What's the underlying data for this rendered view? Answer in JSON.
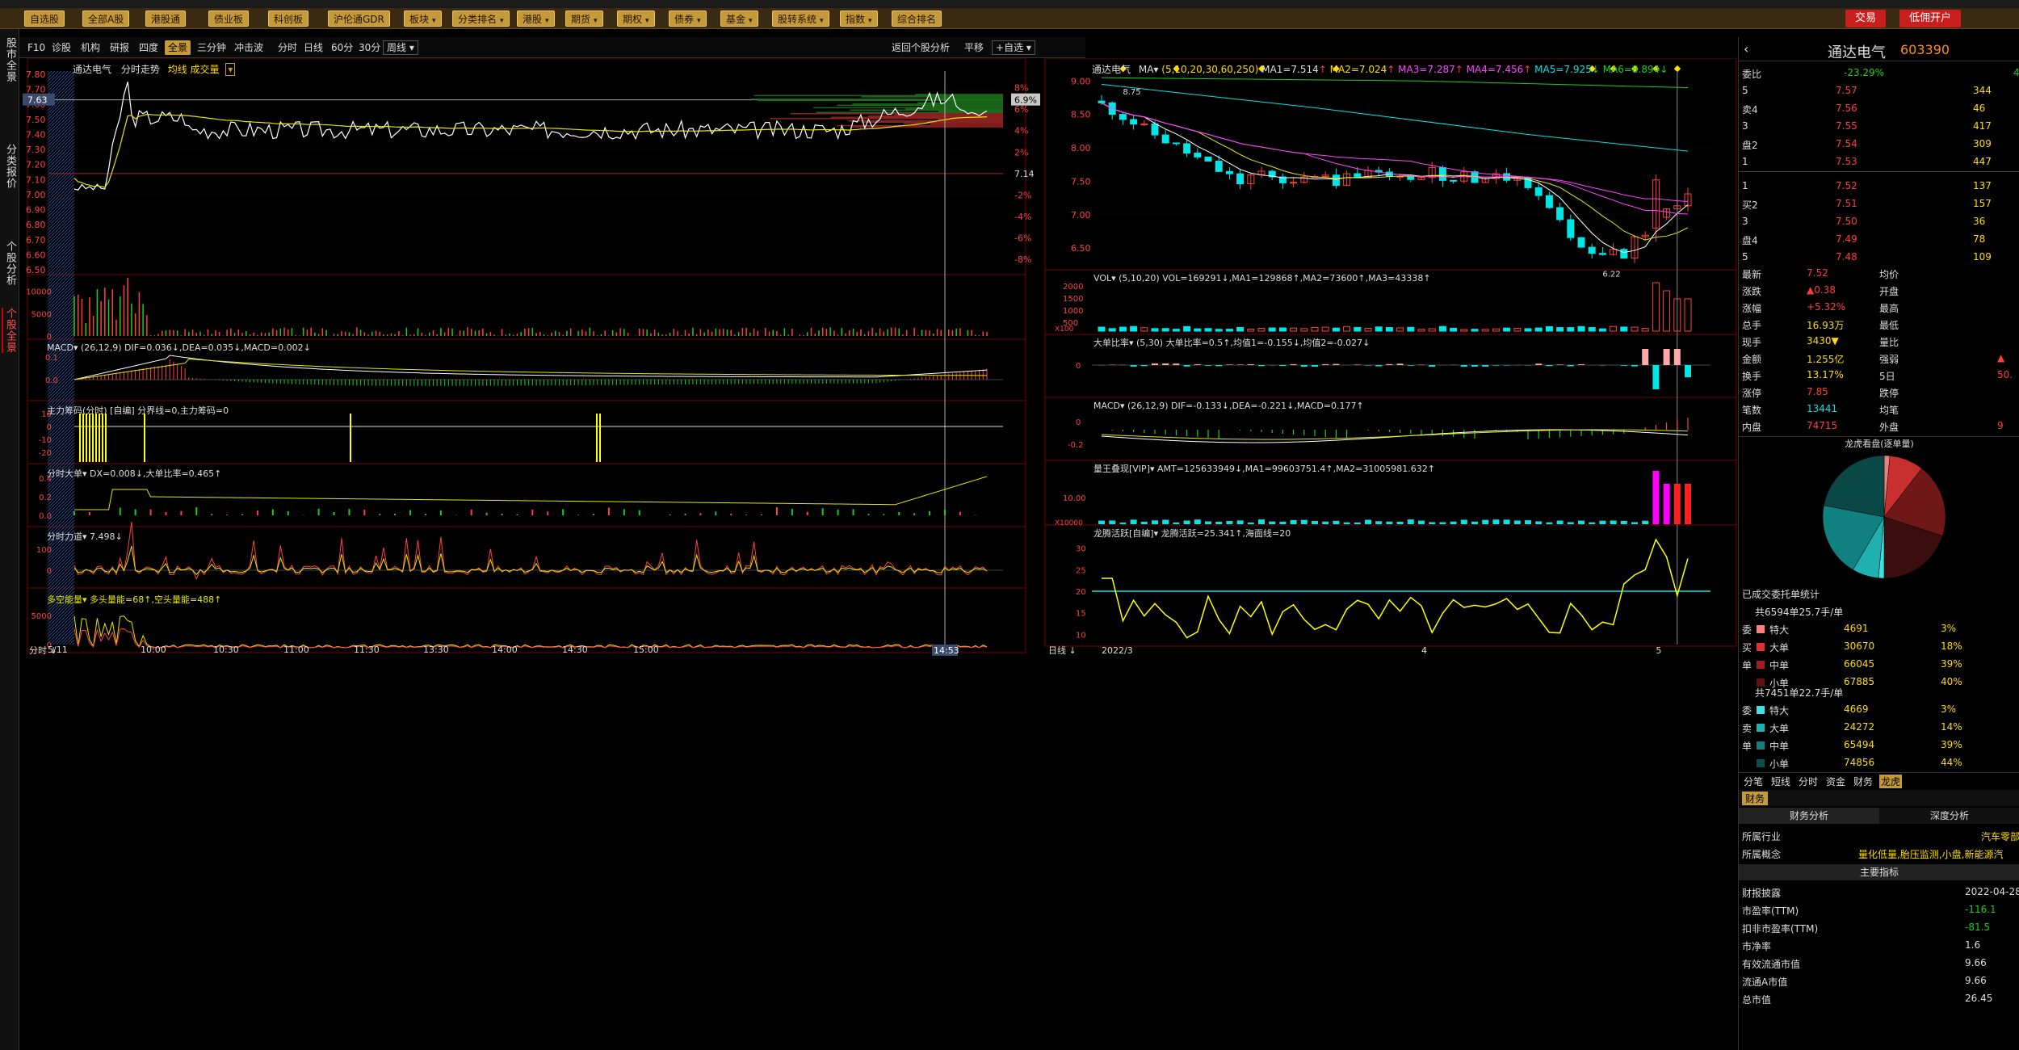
{
  "menubar": {
    "items": [
      "自选股",
      "全部A股",
      "港股通",
      "债业板",
      "科创板",
      "沪伦通GDR",
      "板块",
      "分类排名",
      "港股",
      "期货",
      "期权",
      "债券",
      "基金",
      "股转系统",
      "指数",
      "综合排名"
    ],
    "trade": "交易",
    "account": "低佣开户"
  },
  "leftnav": [
    "股市全景",
    "分类报价",
    "个股分析",
    "个股全景"
  ],
  "toolbar": {
    "left": [
      "F10",
      "诊股",
      "机构",
      "研报",
      "四度",
      "全景",
      "三分钟",
      "冲击波"
    ],
    "active": "全景",
    "periods": [
      "分时",
      "日线",
      "60分",
      "30分"
    ],
    "period_select": "周线",
    "right": [
      "返回个股分析",
      "平移"
    ],
    "custom_select": "自选"
  },
  "intraday": {
    "header": {
      "name": "通达电气",
      "mode": "分时走势",
      "extra": "均线 成交量"
    },
    "price_ticks": [
      "7.80",
      "7.70",
      "7.60",
      "7.50",
      "7.40",
      "7.30",
      "7.20",
      "7.10",
      "7.00",
      "6.90",
      "6.80",
      "6.70",
      "6.60",
      "6.50"
    ],
    "pct_ticks": [
      "8%",
      "6%",
      "4%",
      "2%",
      "-2%",
      "-4%",
      "-6%",
      "-8%"
    ],
    "current_price": "7.63",
    "current_pct": "6.9%",
    "prev_close": "7.14",
    "vol_ticks": [
      "10000",
      "5000",
      "0"
    ],
    "macd": {
      "label": "MACD",
      "params": "(26,12,9)",
      "dif": "DIF=0.036",
      "dea": "DEA=0.035",
      "macd": "MACD=0.002",
      "ticks": [
        "0.1",
        "0.0"
      ]
    },
    "chips": {
      "label": "主力筹码(分时)",
      "mode": "[自编]",
      "line": "分界线=0,主力筹码=0",
      "ticks": [
        "10",
        "0",
        "-10",
        "-20"
      ]
    },
    "bigorder": {
      "label": "分时大单",
      "dx": "DX=0.008",
      "ratio": "大单比率=0.465",
      "ticks": [
        "0.4",
        "0.2",
        "0.0"
      ]
    },
    "force": {
      "label": "分时力道",
      "value": "7.498",
      "ticks": [
        "100",
        "0"
      ]
    },
    "energy": {
      "label": "多空能量",
      "bull": "多头量能=68",
      "bear": "空头量能=488",
      "ticks": [
        "5000",
        "0"
      ]
    },
    "time_ticks": [
      "9:30",
      "10:00",
      "10:30",
      "11:00",
      "11:30",
      "13:30",
      "14:00",
      "14:30",
      "15:00"
    ],
    "date": "5/11",
    "cursor_time": "14:53",
    "bottom_label": "分时"
  },
  "kline": {
    "header": {
      "name": "通达电气",
      "ma_label": "MA",
      "params": "(5,10,20,30,60,250)",
      "ma1": "MA1=7.514",
      "ma2": "MA2=7.024",
      "ma3": "MA3=7.287",
      "ma4": "MA4=7.456",
      "ma5": "MA5=7.925",
      "ma6": "MA6=8.894"
    },
    "price_ticks": [
      "9.00",
      "8.50",
      "8.00",
      "7.50",
      "7.00",
      "6.50"
    ],
    "high_mark": "8.75",
    "low_mark": "6.22",
    "vol": {
      "label": "VOL",
      "params": "(5,10,20)",
      "vol": "VOL=169291",
      "ma1": "MA1=129868",
      "ma2": "MA2=73600",
      "ma3": "MA3=43338",
      "ticks": [
        "2000",
        "1500",
        "1000",
        "500"
      ],
      "unit": "X100"
    },
    "bigratio": {
      "label": "大单比率",
      "params": "(5,30)",
      "value": "大单比率=0.5",
      "avg1": "均值1=-0.155",
      "avg2": "均值2=-0.027",
      "ticks": [
        "0"
      ]
    },
    "macd": {
      "label": "MACD",
      "params": "(26,12,9)",
      "dif": "DIF=-0.133",
      "dea": "DEA=-0.221",
      "macd": "MACD=0.177",
      "ticks": [
        "0",
        "-0.2"
      ]
    },
    "volking": {
      "label": "量王叠现[VIP]",
      "amt": "AMT=125633949",
      "ma1": "MA1=99603751.4",
      "ma2": "MA2=31005981.632",
      "ticks": [
        "10.00"
      ],
      "unit": "X10000"
    },
    "dragon": {
      "label": "龙腾活跃[自编]",
      "active": "龙腾活跃=25.341",
      "sea": "海面线=20",
      "ticks": [
        "30",
        "25",
        "20",
        "15",
        "10"
      ]
    },
    "date_ticks": [
      "2022/3",
      "4",
      "5"
    ],
    "bottom_label": "日线"
  },
  "quote": {
    "name": "通达电气",
    "code": "603390",
    "weibi_label": "委比",
    "weibi": "-23.29%",
    "weibi_diff": "4",
    "asks": [
      {
        "lbl": "5",
        "p": "7.57",
        "v": "344"
      },
      {
        "lbl": "卖4",
        "p": "7.56",
        "v": "46"
      },
      {
        "lbl": "3",
        "p": "7.55",
        "v": "417"
      },
      {
        "lbl": "盘2",
        "p": "7.54",
        "v": "309"
      },
      {
        "lbl": "1",
        "p": "7.53",
        "v": "447"
      }
    ],
    "bids": [
      {
        "lbl": "1",
        "p": "7.52",
        "v": "137"
      },
      {
        "lbl": "买2",
        "p": "7.51",
        "v": "157"
      },
      {
        "lbl": "3",
        "p": "7.50",
        "v": "36"
      },
      {
        "lbl": "盘4",
        "p": "7.49",
        "v": "78"
      },
      {
        "lbl": "5",
        "p": "7.48",
        "v": "109"
      }
    ],
    "stats": [
      {
        "k1": "最新",
        "v1": "7.52",
        "k2": "均价",
        "v2": ""
      },
      {
        "k1": "涨跌",
        "v1": "▲0.38",
        "k2": "开盘",
        "v2": ""
      },
      {
        "k1": "涨幅",
        "v1": "+5.32%",
        "k2": "最高",
        "v2": ""
      },
      {
        "k1": "总手",
        "v1": "16.93万",
        "k2": "最低",
        "v2": ""
      },
      {
        "k1": "现手",
        "v1": "3430▼",
        "k2": "量比",
        "v2": ""
      },
      {
        "k1": "金额",
        "v1": "1.255亿",
        "k2": "强弱",
        "v2": "▲"
      },
      {
        "k1": "换手",
        "v1": "13.17%",
        "k2": "5日",
        "v2": "50."
      },
      {
        "k1": "涨停",
        "v1": "7.85",
        "k2": "跌停",
        "v2": ""
      },
      {
        "k1": "笔数",
        "v1": "13441",
        "k2": "均笔",
        "v2": ""
      },
      {
        "k1": "内盘",
        "v1": "74715",
        "k2": "外盘",
        "v2": "9"
      }
    ],
    "pie_title": "龙虎看盘(逐单量)",
    "pie": [
      {
        "v": 3,
        "c": "#e88080"
      },
      {
        "v": 18,
        "c": "#c83030"
      },
      {
        "v": 39,
        "c": "#701818"
      },
      {
        "v": 40,
        "c": "#3a0e0e"
      },
      {
        "v": 3,
        "c": "#40e0e0"
      },
      {
        "v": 14,
        "c": "#20b0b0"
      },
      {
        "v": 39,
        "c": "#108080"
      },
      {
        "v": 44,
        "c": "#0a4848"
      }
    ],
    "order_title": "已成交委托单统计",
    "buy_total": "共6594单25.7手/单",
    "buy": [
      {
        "side": "委",
        "k": "特大",
        "v": "4691",
        "p": "3%",
        "c": "#ff8080"
      },
      {
        "side": "买",
        "k": "大单",
        "v": "30670",
        "p": "18%",
        "c": "#e03030"
      },
      {
        "side": "单",
        "k": "中单",
        "v": "66045",
        "p": "39%",
        "c": "#a02020"
      },
      {
        "side": "",
        "k": "小单",
        "v": "67885",
        "p": "40%",
        "c": "#601010"
      }
    ],
    "sell_total": "共7451单22.7手/单",
    "sell": [
      {
        "side": "委",
        "k": "特大",
        "v": "4669",
        "p": "3%",
        "c": "#40e0e0"
      },
      {
        "side": "卖",
        "k": "大单",
        "v": "24272",
        "p": "14%",
        "c": "#20b0b0"
      },
      {
        "side": "单",
        "k": "中单",
        "v": "65494",
        "p": "39%",
        "c": "#108080"
      },
      {
        "side": "",
        "k": "小单",
        "v": "74856",
        "p": "44%",
        "c": "#0a5050"
      }
    ],
    "tabs": [
      "分笔",
      "短线",
      "分时",
      "资金",
      "财务",
      "龙虎"
    ],
    "active_tab": "龙虎",
    "fin_tab": "财务",
    "subtabs": [
      "财务分析",
      "深度分析"
    ],
    "industry_label": "所属行业",
    "industry": "汽车零部",
    "concept_label": "所属概念",
    "concept": "量化低量,胎压监测,小盘,新能源汽",
    "main_title": "主要指标",
    "indicators": [
      {
        "k": "财报披露",
        "v": "2022-04-28",
        "c": "white"
      },
      {
        "k": "市盈率(TTM)",
        "v": "-116.1",
        "c": "green"
      },
      {
        "k": "扣非市盈率(TTM)",
        "v": "-81.5",
        "c": "green"
      },
      {
        "k": "市净率",
        "v": "1.6",
        "c": "white"
      },
      {
        "k": "有效流通市值",
        "v": "9.66",
        "c": "white"
      },
      {
        "k": "流通A市值",
        "v": "9.66",
        "c": "white"
      },
      {
        "k": "总市值",
        "v": "26.45",
        "c": "white"
      }
    ]
  }
}
